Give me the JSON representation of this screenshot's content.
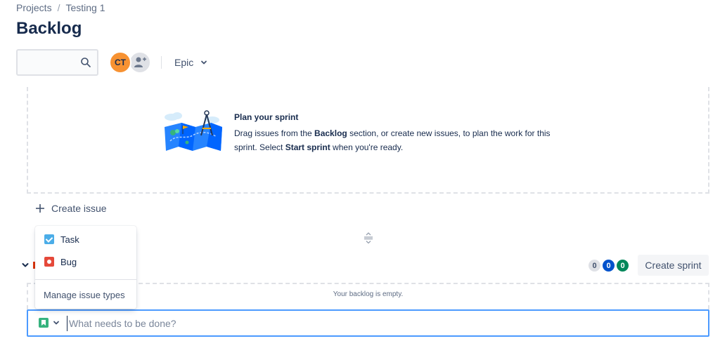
{
  "breadcrumb": {
    "items": [
      "Projects",
      "Testing 1"
    ],
    "separator": "/"
  },
  "page": {
    "title": "Backlog"
  },
  "toolbar": {
    "search_value": "",
    "search_icon": "search-icon",
    "avatar_initials": "CT",
    "avatar_color": "#f79232",
    "add_people_icon": "add-person-icon",
    "epic_filter_label": "Epic"
  },
  "sprint": {
    "empty_title": "Plan your sprint",
    "desc_part1": "Drag issues from the ",
    "desc_bold1": "Backlog",
    "desc_part2": " section, or create new issues, to plan the work for this sprint. Select ",
    "desc_bold2": "Start sprint",
    "desc_part3": " when you're ready.",
    "create_issue_label": "Create issue"
  },
  "issue_type_menu": {
    "items": [
      {
        "label": "Task",
        "icon": "task-icon",
        "color": "#4bade8"
      },
      {
        "label": "Bug",
        "icon": "bug-icon",
        "color": "#e5493a"
      }
    ],
    "manage_label": "Manage issue types"
  },
  "backlog": {
    "counts": {
      "todo": "0",
      "in_progress": "0",
      "done": "0"
    },
    "create_sprint_label": "Create sprint",
    "empty_text": "Your backlog is empty."
  },
  "composer": {
    "placeholder": "What needs to be done?",
    "value": "",
    "type_icon": "story-icon",
    "accent": "#4c9aff"
  }
}
